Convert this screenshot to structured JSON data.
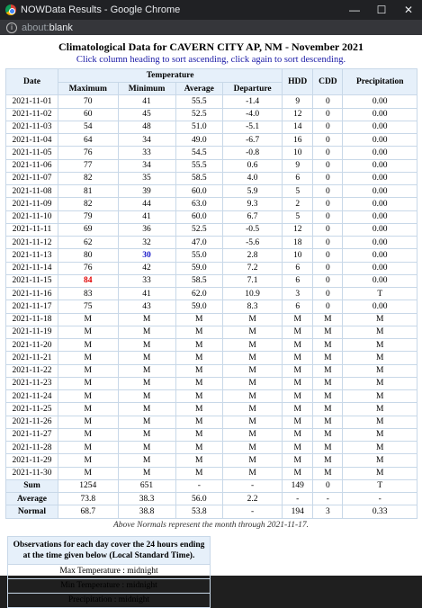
{
  "window": {
    "title": "NOWData Results - Google Chrome",
    "url_scheme": "about:",
    "url_path": "blank"
  },
  "page": {
    "title": "Climatological Data for CAVERN CITY AP, NM - November 2021",
    "instructions": "Click column heading to sort ascending, click again to sort descending.",
    "table": {
      "headers": {
        "date": "Date",
        "temperature": "Temperature",
        "maximum": "Maximum",
        "minimum": "Minimum",
        "average": "Average",
        "departure": "Departure",
        "hdd": "HDD",
        "cdd": "CDD",
        "precipitation": "Precipitation"
      },
      "rows": [
        [
          "2021-11-01",
          "70",
          "41",
          "55.5",
          "-1.4",
          "9",
          "0",
          "0.00"
        ],
        [
          "2021-11-02",
          "60",
          "45",
          "52.5",
          "-4.0",
          "12",
          "0",
          "0.00"
        ],
        [
          "2021-11-03",
          "54",
          "48",
          "51.0",
          "-5.1",
          "14",
          "0",
          "0.00"
        ],
        [
          "2021-11-04",
          "64",
          "34",
          "49.0",
          "-6.7",
          "16",
          "0",
          "0.00"
        ],
        [
          "2021-11-05",
          "76",
          "33",
          "54.5",
          "-0.8",
          "10",
          "0",
          "0.00"
        ],
        [
          "2021-11-06",
          "77",
          "34",
          "55.5",
          "0.6",
          "9",
          "0",
          "0.00"
        ],
        [
          "2021-11-07",
          "82",
          "35",
          "58.5",
          "4.0",
          "6",
          "0",
          "0.00"
        ],
        [
          "2021-11-08",
          "81",
          "39",
          "60.0",
          "5.9",
          "5",
          "0",
          "0.00"
        ],
        [
          "2021-11-09",
          "82",
          "44",
          "63.0",
          "9.3",
          "2",
          "0",
          "0.00"
        ],
        [
          "2021-11-10",
          "79",
          "41",
          "60.0",
          "6.7",
          "5",
          "0",
          "0.00"
        ],
        [
          "2021-11-11",
          "69",
          "36",
          "52.5",
          "-0.5",
          "12",
          "0",
          "0.00"
        ],
        [
          "2021-11-12",
          "62",
          "32",
          "47.0",
          "-5.6",
          "18",
          "0",
          "0.00"
        ],
        [
          "2021-11-13",
          "80",
          "30",
          "55.0",
          "2.8",
          "10",
          "0",
          "0.00"
        ],
        [
          "2021-11-14",
          "76",
          "42",
          "59.0",
          "7.2",
          "6",
          "0",
          "0.00"
        ],
        [
          "2021-11-15",
          "84",
          "33",
          "58.5",
          "7.1",
          "6",
          "0",
          "0.00"
        ],
        [
          "2021-11-16",
          "83",
          "41",
          "62.0",
          "10.9",
          "3",
          "0",
          "T"
        ],
        [
          "2021-11-17",
          "75",
          "43",
          "59.0",
          "8.3",
          "6",
          "0",
          "0.00"
        ],
        [
          "2021-11-18",
          "M",
          "M",
          "M",
          "M",
          "M",
          "M",
          "M"
        ],
        [
          "2021-11-19",
          "M",
          "M",
          "M",
          "M",
          "M",
          "M",
          "M"
        ],
        [
          "2021-11-20",
          "M",
          "M",
          "M",
          "M",
          "M",
          "M",
          "M"
        ],
        [
          "2021-11-21",
          "M",
          "M",
          "M",
          "M",
          "M",
          "M",
          "M"
        ],
        [
          "2021-11-22",
          "M",
          "M",
          "M",
          "M",
          "M",
          "M",
          "M"
        ],
        [
          "2021-11-23",
          "M",
          "M",
          "M",
          "M",
          "M",
          "M",
          "M"
        ],
        [
          "2021-11-24",
          "M",
          "M",
          "M",
          "M",
          "M",
          "M",
          "M"
        ],
        [
          "2021-11-25",
          "M",
          "M",
          "M",
          "M",
          "M",
          "M",
          "M"
        ],
        [
          "2021-11-26",
          "M",
          "M",
          "M",
          "M",
          "M",
          "M",
          "M"
        ],
        [
          "2021-11-27",
          "M",
          "M",
          "M",
          "M",
          "M",
          "M",
          "M"
        ],
        [
          "2021-11-28",
          "M",
          "M",
          "M",
          "M",
          "M",
          "M",
          "M"
        ],
        [
          "2021-11-29",
          "M",
          "M",
          "M",
          "M",
          "M",
          "M",
          "M"
        ],
        [
          "2021-11-30",
          "M",
          "M",
          "M",
          "M",
          "M",
          "M",
          "M"
        ]
      ],
      "highlights": [
        {
          "row": 14,
          "col": 1,
          "color": "#e00000"
        },
        {
          "row": 12,
          "col": 2,
          "color": "#1818c8"
        }
      ],
      "summary": [
        [
          "Sum",
          "1254",
          "651",
          "-",
          "-",
          "149",
          "0",
          "T"
        ],
        [
          "Average",
          "73.8",
          "38.3",
          "56.0",
          "2.2",
          "-",
          "-",
          "-"
        ],
        [
          "Normal",
          "68.7",
          "38.8",
          "53.8",
          "-",
          "194",
          "3",
          "0.33"
        ]
      ]
    },
    "normals_note": "Above Normals represent the month through 2021-11-17.",
    "observations": {
      "heading": "Observations for each day cover the 24 hours ending at the time given below (Local Standard Time).",
      "items": [
        "Max Temperature : midnight",
        "Min Temperature : midnight",
        "Precipitation : midnight"
      ]
    }
  },
  "colors": {
    "header_bg": "#e6f0fa",
    "border": "#c8d8e8",
    "link_blue": "#1a1aa6"
  }
}
